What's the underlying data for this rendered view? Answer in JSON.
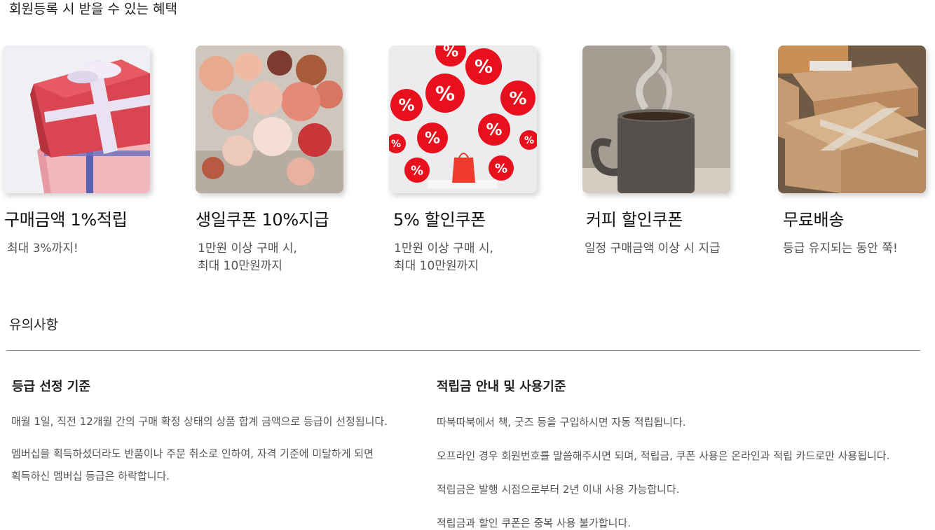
{
  "benefits": {
    "title": "회원등록 시 받을 수 있는 혜택",
    "cards": [
      {
        "title": "구매금액 1%적립",
        "desc_lines": [
          "최대 3%까지!"
        ],
        "image": "gift-boxes"
      },
      {
        "title": "생일쿠폰 10%지급",
        "desc_lines": [
          "1만원 이상 구매 시,",
          "최대 10만원까지"
        ],
        "image": "flower-bouquet"
      },
      {
        "title": "5% 할인쿠폰",
        "desc_lines": [
          "1만원 이상 구매 시,",
          "최대 10만원까지"
        ],
        "image": "percent-balloons"
      },
      {
        "title": "커피 할인쿠폰",
        "desc_lines": [
          "일정 구매금액 이상 시 지급"
        ],
        "image": "coffee-mug"
      },
      {
        "title": "무료배송",
        "desc_lines": [
          "등급 유지되는 동안 쭉!"
        ],
        "image": "cardboard-boxes"
      }
    ]
  },
  "notice": {
    "title": "유의사항",
    "left": {
      "title": "등급 선정 기준",
      "paragraphs": [
        [
          "매월 1일, 직전 12개월 간의 구매 확정 상태의 상품 합계 금액으로 등급이 선정됩니다."
        ],
        [
          "멤버십을 획득하셨더라도 반품이나 주문 취소로 인하여, 자격 기준에 미달하게 되면",
          "획득하신 멤버십 등급은 하락합니다."
        ]
      ]
    },
    "right": {
      "title": "적립금 안내 및 사용기준",
      "paragraphs": [
        [
          "따북따북에서 책, 굿즈 등을 구입하시면 자동 적립됩니다."
        ],
        [
          "오프라인 경우 회원번호를 말씀해주시면 되며, 적립금, 쿠폰 사용은 온라인과 적립 카드로만 사용됩니다."
        ],
        [
          "적립금은 발행 시점으로부터 2년 이내 사용 가능합니다."
        ],
        [
          "적립금과 할인 쿠폰은 중복 사용 불가합니다."
        ]
      ]
    }
  },
  "balloon_label": "%"
}
